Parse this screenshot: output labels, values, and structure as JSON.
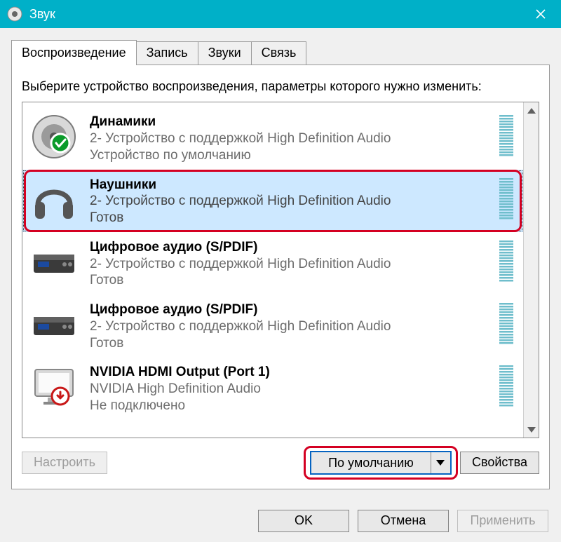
{
  "window": {
    "title": "Звук"
  },
  "tabs": [
    {
      "label": "Воспроизведение",
      "active": true
    },
    {
      "label": "Запись",
      "active": false
    },
    {
      "label": "Звуки",
      "active": false
    },
    {
      "label": "Связь",
      "active": false
    }
  ],
  "instruction": "Выберите устройство воспроизведения, параметры которого нужно изменить:",
  "devices": [
    {
      "title": "Динамики",
      "desc": "2- Устройство с поддержкой High Definition Audio",
      "status": "Устройство по умолчанию",
      "icon": "speaker",
      "badge": "default",
      "selected": false,
      "highlighted": false
    },
    {
      "title": "Наушники",
      "desc": "2- Устройство с поддержкой High Definition Audio",
      "status": "Готов",
      "icon": "headphones",
      "badge": null,
      "selected": true,
      "highlighted": true
    },
    {
      "title": "Цифровое аудио (S/PDIF)",
      "desc": "2- Устройство с поддержкой High Definition Audio",
      "status": "Готов",
      "icon": "receiver",
      "badge": null,
      "selected": false,
      "highlighted": false
    },
    {
      "title": "Цифровое аудио (S/PDIF)",
      "desc": "2- Устройство с поддержкой High Definition Audio",
      "status": "Готов",
      "icon": "receiver",
      "badge": null,
      "selected": false,
      "highlighted": false
    },
    {
      "title": "NVIDIA HDMI Output (Port 1)",
      "desc": "NVIDIA High Definition Audio",
      "status": "Не подключено",
      "icon": "monitor",
      "badge": "disconnected",
      "selected": false,
      "highlighted": false
    }
  ],
  "buttons": {
    "configure": "Настроить",
    "set_default": "По умолчанию",
    "set_default_highlighted": true,
    "properties": "Свойства",
    "ok": "OK",
    "cancel": "Отмена",
    "apply": "Применить"
  }
}
